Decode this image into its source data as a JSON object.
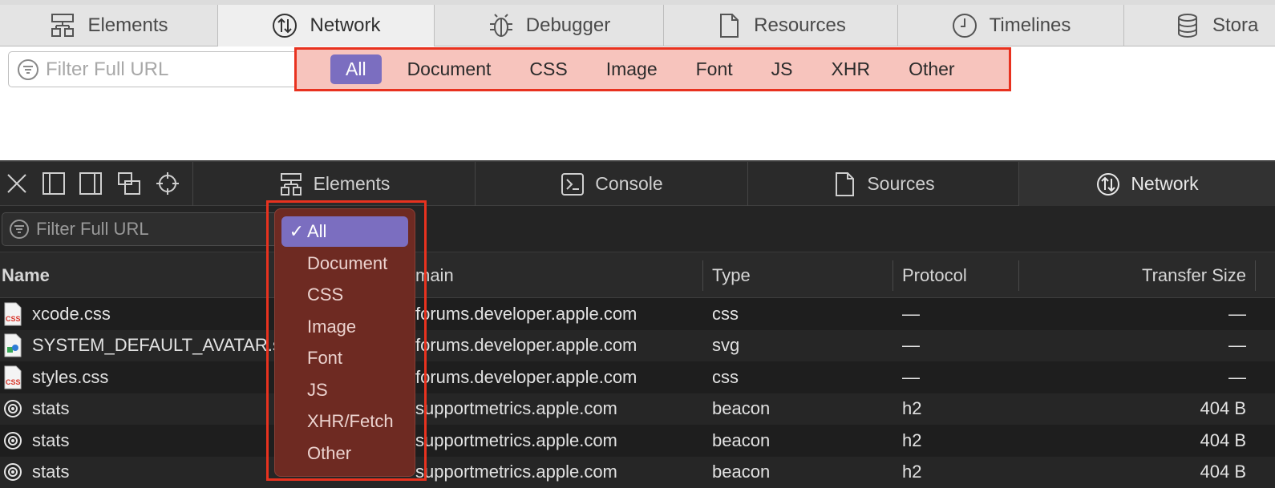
{
  "top": {
    "tabs": [
      {
        "label": "Elements",
        "icon": "elements-icon"
      },
      {
        "label": "Network",
        "icon": "network-icon",
        "active": true
      },
      {
        "label": "Debugger",
        "icon": "debugger-icon"
      },
      {
        "label": "Resources",
        "icon": "resources-icon"
      },
      {
        "label": "Timelines",
        "icon": "timelines-icon"
      },
      {
        "label": "Stora",
        "icon": "storage-icon"
      }
    ],
    "filter_placeholder": "Filter Full URL",
    "scope_items": [
      "All",
      "Document",
      "CSS",
      "Image",
      "Font",
      "JS",
      "XHR",
      "Other"
    ],
    "scope_selected": "All",
    "highlight_color": "#e8321f"
  },
  "bottom": {
    "tabs": [
      {
        "label": "Elements",
        "icon": "elements-icon"
      },
      {
        "label": "Console",
        "icon": "console-icon"
      },
      {
        "label": "Sources",
        "icon": "sources-icon"
      },
      {
        "label": "Network",
        "icon": "network-icon",
        "active": true
      }
    ],
    "filter_placeholder": "Filter Full URL",
    "columns": [
      "Name",
      "Domain",
      "Type",
      "Protocol",
      "Transfer Size"
    ],
    "visible_domain_header": "main",
    "rows": [
      {
        "name": "xcode.css",
        "icon": "css-file-icon",
        "domain": "forums.developer.apple.com",
        "type": "css",
        "protocol": "—",
        "size": "—"
      },
      {
        "name": "SYSTEM_DEFAULT_AVATAR.s",
        "icon": "image-file-icon",
        "domain": "forums.developer.apple.com",
        "type": "svg",
        "protocol": "—",
        "size": "—"
      },
      {
        "name": "styles.css",
        "icon": "css-file-icon",
        "domain": "forums.developer.apple.com",
        "type": "css",
        "protocol": "—",
        "size": "—"
      },
      {
        "name": "stats",
        "icon": "beacon-icon",
        "domain": "supportmetrics.apple.com",
        "type": "beacon",
        "protocol": "h2",
        "size": "404 B"
      },
      {
        "name": "stats",
        "icon": "beacon-icon",
        "domain": "supportmetrics.apple.com",
        "type": "beacon",
        "protocol": "h2",
        "size": "404 B"
      },
      {
        "name": "stats",
        "icon": "beacon-icon",
        "domain": "supportmetrics.apple.com",
        "type": "beacon",
        "protocol": "h2",
        "size": "404 B"
      }
    ],
    "menu": {
      "checkmark": "✓",
      "items": [
        "All",
        "Document",
        "CSS",
        "Image",
        "Font",
        "JS",
        "XHR/Fetch",
        "Other"
      ],
      "selected": "All",
      "bg_color": "#6e2a22",
      "selected_color": "#7b6ec0"
    }
  }
}
